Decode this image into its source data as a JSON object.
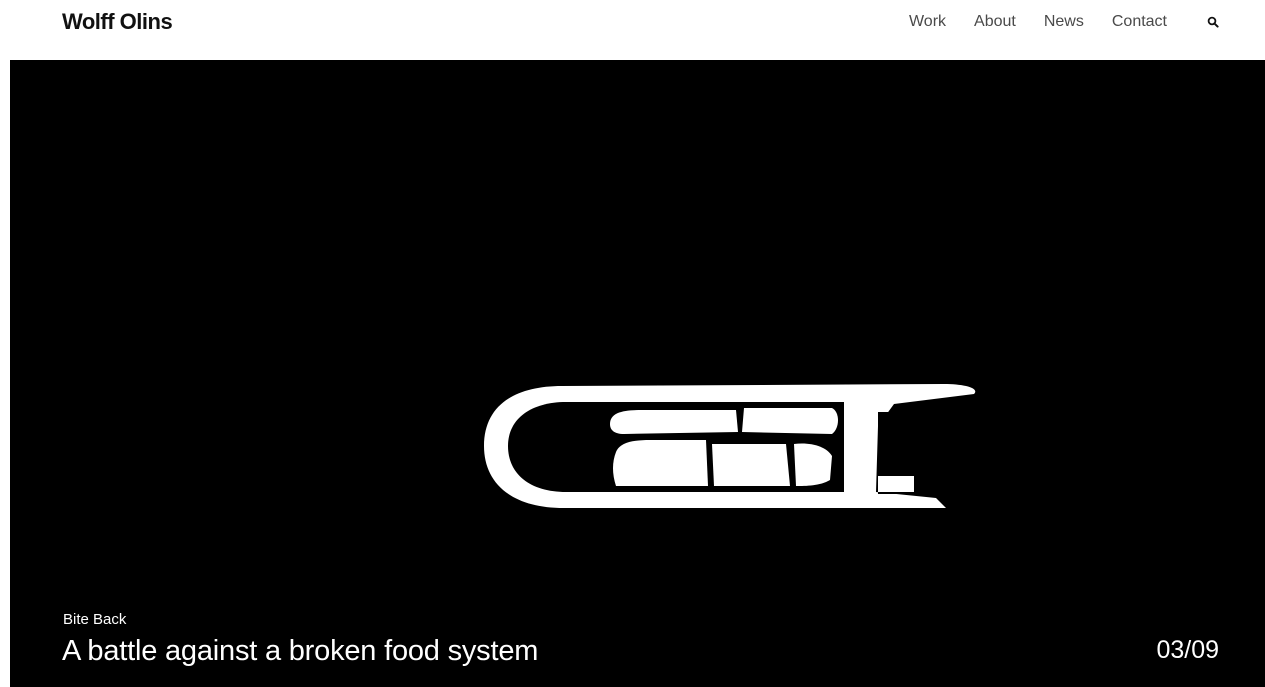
{
  "header": {
    "logo_text": "Wolff Olins",
    "nav": [
      {
        "label": "Work"
      },
      {
        "label": "About"
      },
      {
        "label": "News"
      },
      {
        "label": "Contact"
      }
    ],
    "search_icon": "search-icon"
  },
  "hero": {
    "background_color": "#000000",
    "art_icon": "bite-back-graphic",
    "eyebrow": "Bite Back",
    "headline": "A battle against a broken food system",
    "counter": "03/09"
  }
}
